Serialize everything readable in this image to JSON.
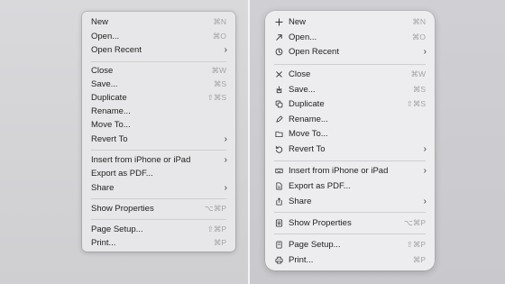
{
  "colors": {
    "menu_bg_old": "#e7e7e9",
    "menu_bg_new": "#ededf0",
    "text": "#222222",
    "shortcut": "#a3a3a7"
  },
  "old_menu": {
    "items": [
      {
        "label": "New",
        "shortcut": "⌘N"
      },
      {
        "label": "Open...",
        "shortcut": "⌘O"
      },
      {
        "label": "Open Recent",
        "submenu": "›"
      },
      {
        "label": "Close",
        "shortcut": "⌘W"
      },
      {
        "label": "Save...",
        "shortcut": "⌘S"
      },
      {
        "label": "Duplicate",
        "shortcut": "⇧⌘S"
      },
      {
        "label": "Rename..."
      },
      {
        "label": "Move To..."
      },
      {
        "label": "Revert To",
        "submenu": "›"
      },
      {
        "label": "Insert from iPhone or iPad",
        "submenu": "›"
      },
      {
        "label": "Export as PDF..."
      },
      {
        "label": "Share",
        "submenu": "›"
      },
      {
        "label": "Show Properties",
        "shortcut": "⌥⌘P"
      },
      {
        "label": "Page Setup...",
        "shortcut": "⇧⌘P"
      },
      {
        "label": "Print...",
        "shortcut": "⌘P"
      }
    ]
  },
  "new_menu": {
    "items": [
      {
        "label": "New",
        "shortcut": "⌘N",
        "icon": "plus-icon"
      },
      {
        "label": "Open...",
        "shortcut": "⌘O",
        "icon": "arrow-up-right-icon"
      },
      {
        "label": "Open Recent",
        "submenu": "›",
        "icon": "clock-icon"
      },
      {
        "label": "Close",
        "shortcut": "⌘W",
        "icon": "xmark-icon"
      },
      {
        "label": "Save...",
        "shortcut": "⌘S",
        "icon": "save-icon"
      },
      {
        "label": "Duplicate",
        "shortcut": "⇧⌘S",
        "icon": "duplicate-icon"
      },
      {
        "label": "Rename...",
        "icon": "pencil-icon"
      },
      {
        "label": "Move To...",
        "icon": "folder-icon"
      },
      {
        "label": "Revert To",
        "submenu": "›",
        "icon": "revert-icon"
      },
      {
        "label": "Insert from iPhone or iPad",
        "submenu": "›",
        "icon": "keyboard-icon"
      },
      {
        "label": "Export as PDF...",
        "icon": "document-icon"
      },
      {
        "label": "Share",
        "submenu": "›",
        "icon": "share-icon"
      },
      {
        "label": "Show Properties",
        "shortcut": "⌥⌘P",
        "icon": "properties-icon"
      },
      {
        "label": "Page Setup...",
        "shortcut": "⇧⌘P",
        "icon": "page-setup-icon"
      },
      {
        "label": "Print...",
        "shortcut": "⌘P",
        "icon": "printer-icon"
      }
    ]
  }
}
